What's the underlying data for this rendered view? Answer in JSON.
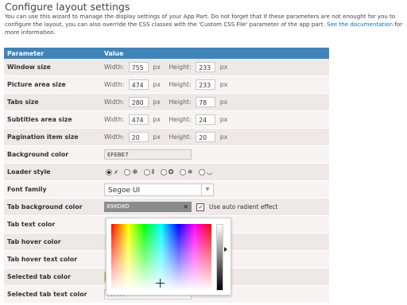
{
  "header": {
    "title": "Configure layout settings",
    "desc_text": "You can use this wizard to manage the display settings of your App Part. Do not forget that if these parameters are not enought for you to configure the layout, you can also override the CSS classes with the 'Custom CSS File' parameter of the app part.",
    "desc_link_1": "See the",
    "desc_link_2": "documentation",
    "desc_tail": "for more information."
  },
  "table": {
    "col_parameter": "Parameter",
    "col_value": "Value",
    "width_label": "Width:",
    "height_label": "Height:",
    "px": "px",
    "rows": {
      "window_size": {
        "label": "Window size",
        "width": "755",
        "height": "233"
      },
      "picture_area_size": {
        "label": "Picture area size",
        "width": "474",
        "height": "233"
      },
      "tabs_size": {
        "label": "Tabs size",
        "width": "280",
        "height": "78"
      },
      "subtitles_area_size": {
        "label": "Subtitles area size",
        "width": "474",
        "height": "24"
      },
      "pagination_item_size": {
        "label": "Pagination item size",
        "width": "20",
        "height": "20"
      },
      "background_color": {
        "label": "Background color",
        "value": "EFEBE7",
        "color": "#efebe7"
      },
      "loader_style": {
        "label": "Loader style",
        "selected_index": 0
      },
      "font_family": {
        "label": "Font family",
        "value": "Segoe UI"
      },
      "tab_background_color": {
        "label": "Tab background color",
        "value": "898D8D",
        "color": "#898d8d",
        "clear_icon": "close-icon",
        "checkbox_checked": true,
        "checkbox_label": "Use auto radient effect"
      },
      "tab_text_color": {
        "label": "Tab text color"
      },
      "tab_hover_color": {
        "label": "Tab hover color"
      },
      "tab_hover_text_color": {
        "label": "Tab hover text color"
      },
      "selected_tab_color": {
        "label": "Selected tab color",
        "color": "#e6a817"
      },
      "selected_tab_text_color": {
        "label": "Selected tab text color",
        "value": "FFFFFF",
        "color": "#ffffff"
      }
    }
  },
  "colors": {
    "header_bg": "#3f83b9",
    "row_odd": "#eee8e6",
    "row_even": "#f7f3f2",
    "link": "#0072c6"
  }
}
